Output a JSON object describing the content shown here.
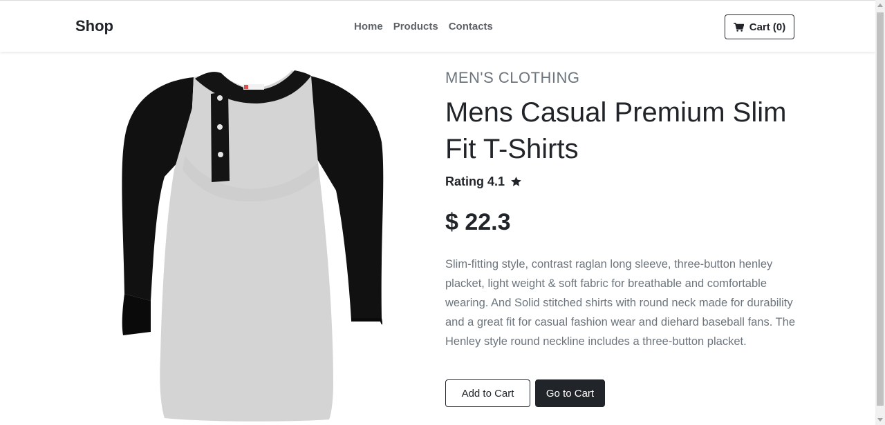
{
  "header": {
    "brand": "Shop",
    "nav": [
      {
        "label": "Home"
      },
      {
        "label": "Products"
      },
      {
        "label": "Contacts"
      }
    ],
    "cart_label": "Cart (0)",
    "cart_icon": "shopping-cart-icon"
  },
  "product": {
    "category": "MEN'S CLOTHING",
    "title": "Mens Casual Premium Slim Fit T-Shirts",
    "rating_label": "Rating 4.1",
    "rating_icon": "star-icon",
    "price": "$ 22.3",
    "description": "Slim-fitting style, contrast raglan long sleeve, three-button henley placket, light weight & soft fabric for breathable and comfortable wearing. And Solid stitched shirts with round neck made for durability and a great fit for casual fashion wear and diehard baseball fans. The Henley style round neckline includes a three-button placket.",
    "image_alt": "Mens Casual Premium Slim Fit T-Shirts"
  },
  "actions": {
    "add_to_cart": "Add to Cart",
    "go_to_cart": "Go to Cart"
  },
  "colors": {
    "dark": "#212529",
    "muted": "#6c757d",
    "shirt_body": "#d4d4d4",
    "shirt_sleeves": "#111111"
  }
}
